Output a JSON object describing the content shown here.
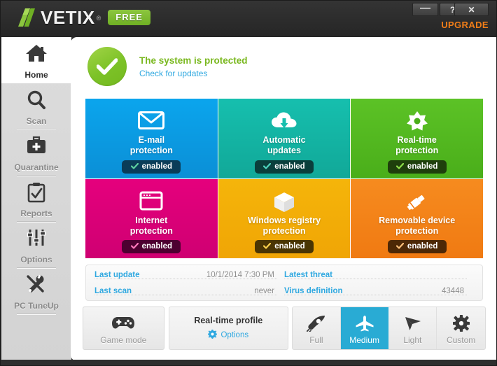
{
  "titlebar": {
    "brand_prefix": "A",
    "brand_rest": "VETIX",
    "registered_mark": "®",
    "edition_badge": "FREE",
    "minimize_label": "—",
    "help_label": "?",
    "close_label": "✕",
    "upgrade_label": "UPGRADE",
    "accent_green": "#8cc63f",
    "accent_orange": "#f07d18",
    "bar_color": "#2e2e2e"
  },
  "sidebar": {
    "items": [
      {
        "label": "Home",
        "icon": "home-icon",
        "active": true
      },
      {
        "label": "Scan",
        "icon": "magnifier-icon",
        "active": false
      },
      {
        "label": "Quarantine",
        "icon": "briefcase-icon",
        "active": false
      },
      {
        "label": "Reports",
        "icon": "clipboard-check-icon",
        "active": false
      },
      {
        "label": "Options",
        "icon": "sliders-icon",
        "active": false
      },
      {
        "label": "PC TuneUp",
        "icon": "tools-icon",
        "active": false
      }
    ]
  },
  "status": {
    "icon": "check-circle-icon",
    "title": "The system is protected",
    "link": "Check for updates",
    "title_color": "#7ab81f",
    "link_color": "#2fa8e0",
    "circle_color": "#7cc227"
  },
  "tiles": [
    {
      "title_line1": "E-mail",
      "title_line2": "protection",
      "icon": "envelope-icon",
      "status": "enabled",
      "color_top": "#0ba5ed",
      "color_bottom": "#0b8fd6",
      "pill_color": "#0a3c58"
    },
    {
      "title_line1": "Automatic",
      "title_line2": "updates",
      "icon": "cloud-download-icon",
      "status": "enabled",
      "color_top": "#16bfae",
      "color_bottom": "#11a898",
      "pill_color": "#0a3f3c"
    },
    {
      "title_line1": "Real-time",
      "title_line2": "protection",
      "icon": "shield-star-icon",
      "status": "enabled",
      "color_top": "#5cc226",
      "color_bottom": "#4aae1a",
      "pill_color": "#1f3f0c"
    },
    {
      "title_line1": "Internet",
      "title_line2": "protection",
      "icon": "browser-window-icon",
      "status": "enabled",
      "color_top": "#e5007d",
      "color_bottom": "#cf0072",
      "pill_color": "#4d0030"
    },
    {
      "title_line1": "Windows registry",
      "title_line2": "protection",
      "icon": "cube-icon",
      "status": "enabled",
      "color_top": "#f5b50a",
      "color_bottom": "#f0a505",
      "pill_color": "#4a3503"
    },
    {
      "title_line1": "Removable device",
      "title_line2": "protection",
      "icon": "usb-drive-icon",
      "status": "enabled",
      "color_top": "#f68b1f",
      "color_bottom": "#f07a12",
      "pill_color": "#4d2806"
    }
  ],
  "info": {
    "rows": [
      {
        "key": "Last update",
        "value": "10/1/2014 7:30 PM"
      },
      {
        "key": "Latest threat",
        "value": ""
      },
      {
        "key": "Last scan",
        "value": "never"
      },
      {
        "key": "Virus definition",
        "value": "43448"
      }
    ]
  },
  "bottom": {
    "game_mode": {
      "label": "Game mode",
      "icon": "gamepad-icon"
    },
    "profile": {
      "title": "Real-time profile",
      "options_label": "Options",
      "options_icon": "gear-icon"
    },
    "levels": [
      {
        "label": "Full",
        "icon": "rocket-icon",
        "selected": false
      },
      {
        "label": "Medium",
        "icon": "airplane-icon",
        "selected": true
      },
      {
        "label": "Light",
        "icon": "cursor-icon",
        "selected": false
      },
      {
        "label": "Custom",
        "icon": "gear-icon",
        "selected": false
      }
    ],
    "selected_color": "#29abd4"
  }
}
